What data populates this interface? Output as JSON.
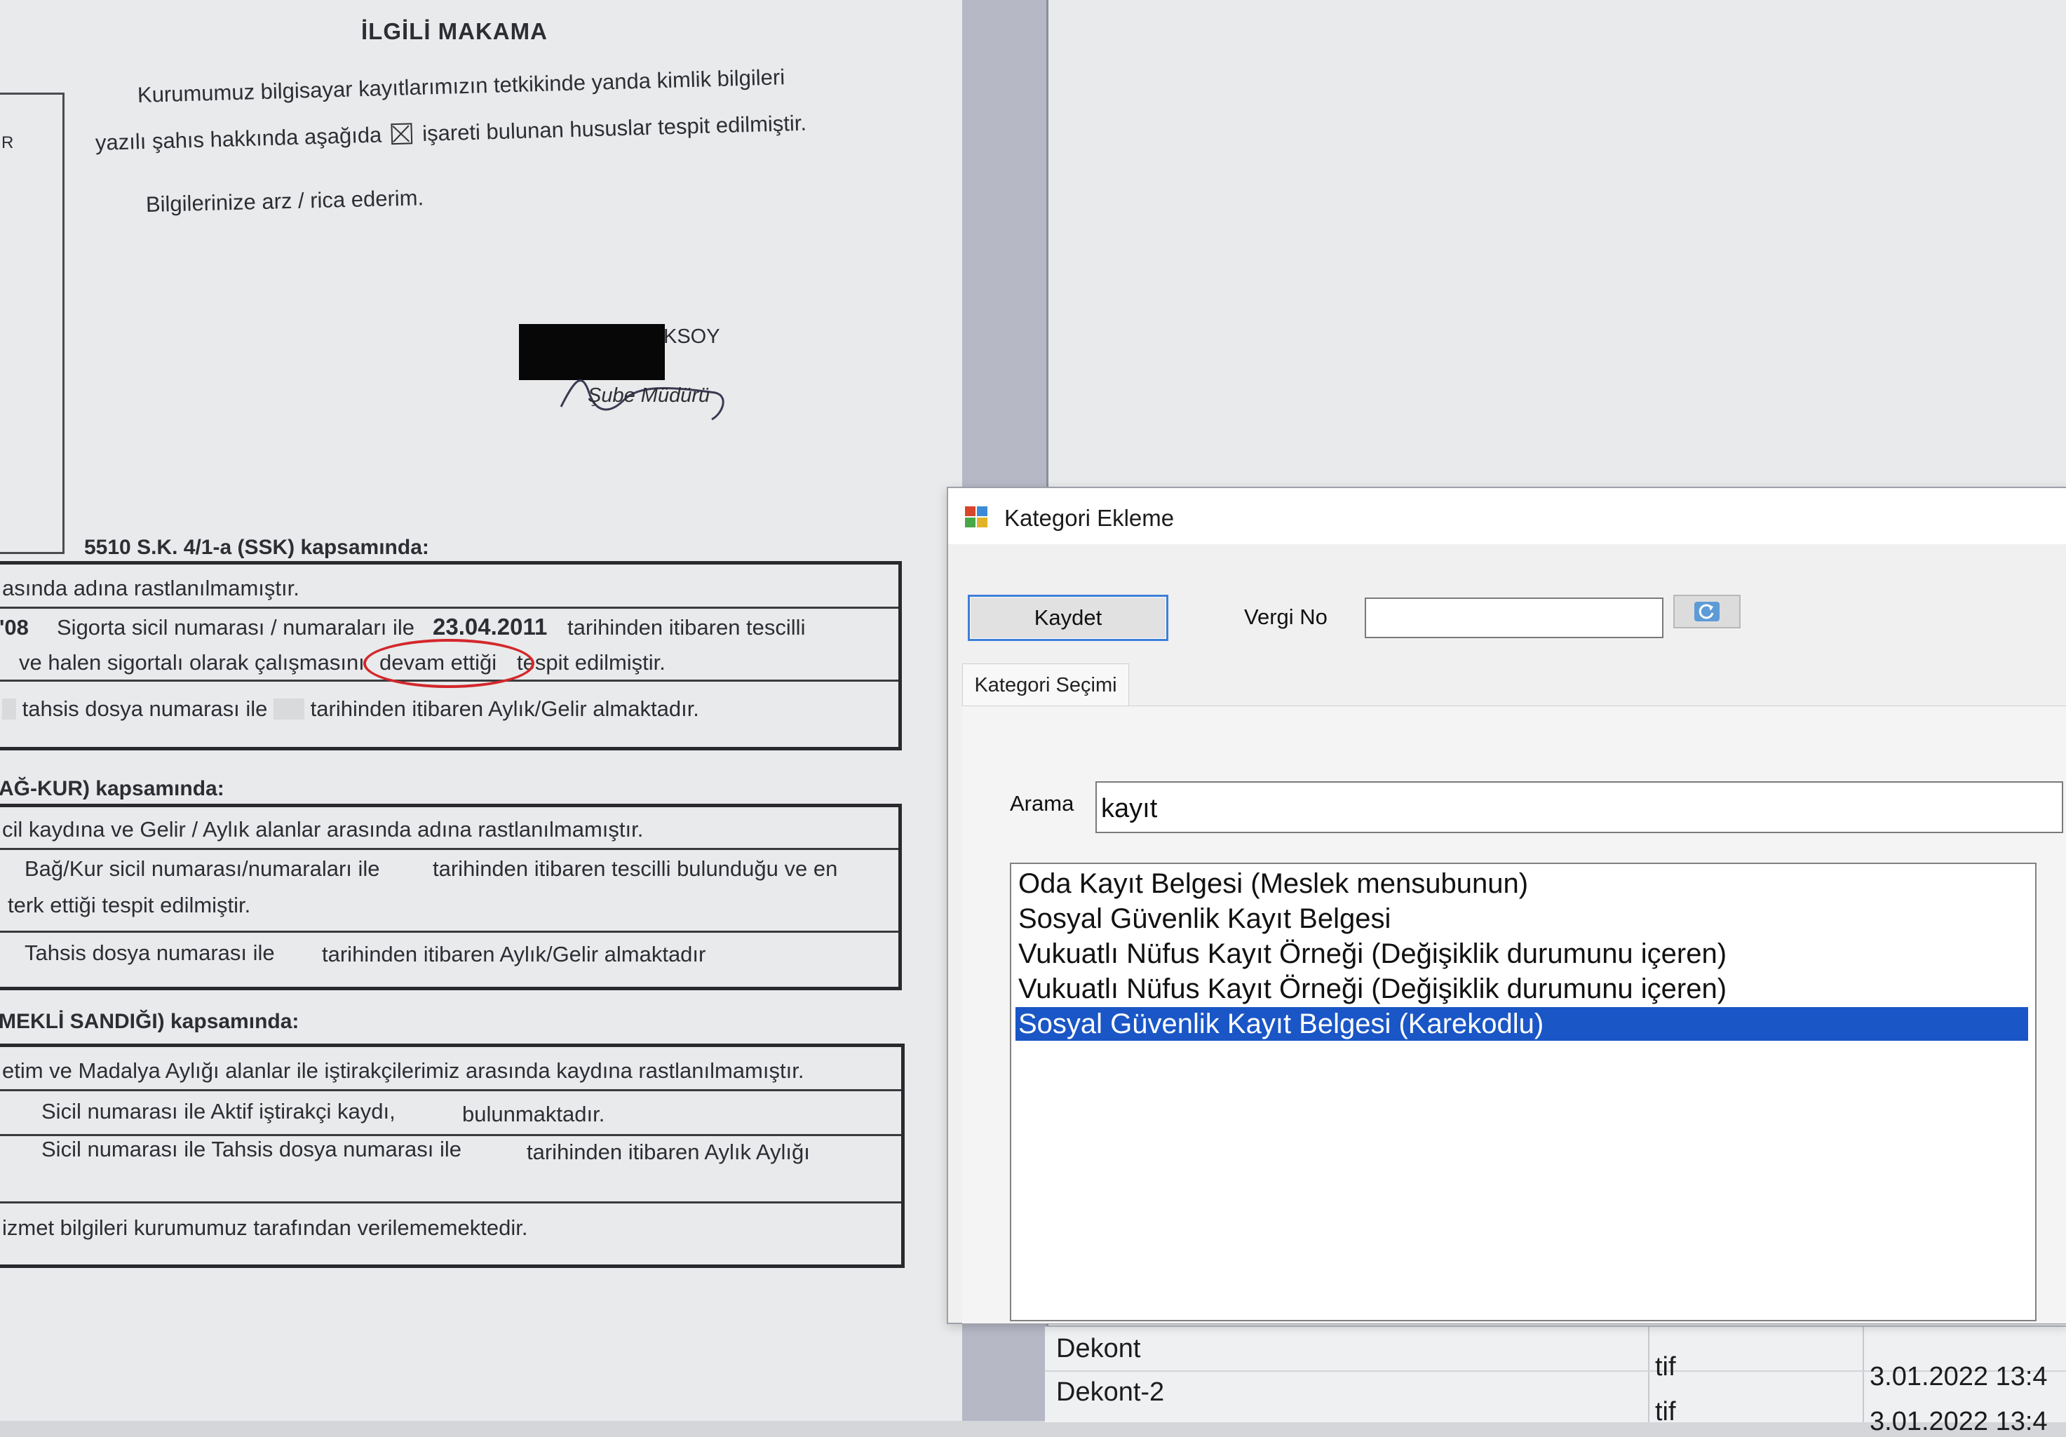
{
  "document": {
    "title": "İLGİLİ MAKAMA",
    "intro_line1": "Kurumumuz bilgisayar kayıtlarımızın tetkikinde yanda kimlik bilgileri",
    "intro_line2_a": "yazılı şahıs hakkında aşağıda",
    "intro_line2_b": "işareti bulunan hususlar tespit edilmiştir.",
    "regards": "Bilgilerinize arz / rica ederim.",
    "side_letter": "R",
    "signatory_name": "KSOY",
    "signatory_title": "Şube Müdürü",
    "sections": [
      {
        "heading": "5510 S.K. 4/1-a (SSK) kapsamında:",
        "rows": [
          "asında adına rastlanılmamıştır.",
          "'08",
          "Sigorta sicil numarası / numaraları ile",
          "23.04.2011",
          "tarihinden itibaren tescilli",
          "ve halen sigortalı olarak çalışmasını",
          "devam ettiği",
          "tespit edilmiştir.",
          "tahsis dosya numarası ile",
          "tarihinden itibaren Aylık/Gelir almaktadır."
        ]
      },
      {
        "heading": "AĞ-KUR) kapsamında:",
        "rows": [
          "cil kaydına ve Gelir / Aylık alanlar arasında adına rastlanılmamıştır.",
          "Bağ/Kur sicil numarası/numaraları ile",
          "tarihinden itibaren tescilli bulunduğu ve en",
          "terk  ettiği tespit edilmiştir.",
          "Tahsis dosya numarası ile",
          "tarihinden itibaren Aylık/Gelir almaktadır"
        ]
      },
      {
        "heading": "MEKLİ SANDIĞI) kapsamında:",
        "rows": [
          "etim ve Madalya Aylığı alanlar ile iştirakçilerimiz arasında kaydına rastlanılmamıştır.",
          "Sicil numarası ile Aktif  iştirakçi kaydı,",
          "bulunmaktadır.",
          "Sicil numarası ile Tahsis dosya numarası ile",
          "tarihinden itibaren Aylık Aylığı",
          "izmet bilgileri kurumumuz tarafından verilememektedir."
        ]
      }
    ]
  },
  "dialog": {
    "title": "Kategori Ekleme",
    "save_button": "Kaydet",
    "tax_no_label": "Vergi No",
    "tax_no_value": "",
    "tab_label": "Kategori Seçimi",
    "search_label": "Arama",
    "search_value": "kayıt",
    "list_items": [
      "Oda Kayıt Belgesi (Meslek mensubunun)",
      "Sosyal Güvenlik Kayıt Belgesi",
      "Vukuatlı Nüfus Kayıt Örneği (Değişiklik durumunu içeren)",
      "Vukuatlı Nüfus Kayıt Örneği (Değişiklik durumunu içeren)",
      "Sosyal Güvenlik Kayıt Belgesi (Karekodlu)"
    ],
    "selected_index": 4,
    "selection_color": "#1a56c6"
  },
  "background_grid": {
    "rows": [
      {
        "name": "Dekont",
        "ext": "tif",
        "date": "3.01.2022 13:4"
      },
      {
        "name": "Dekont-2",
        "ext": "tif",
        "date": "3.01.2022 13:4"
      }
    ]
  }
}
